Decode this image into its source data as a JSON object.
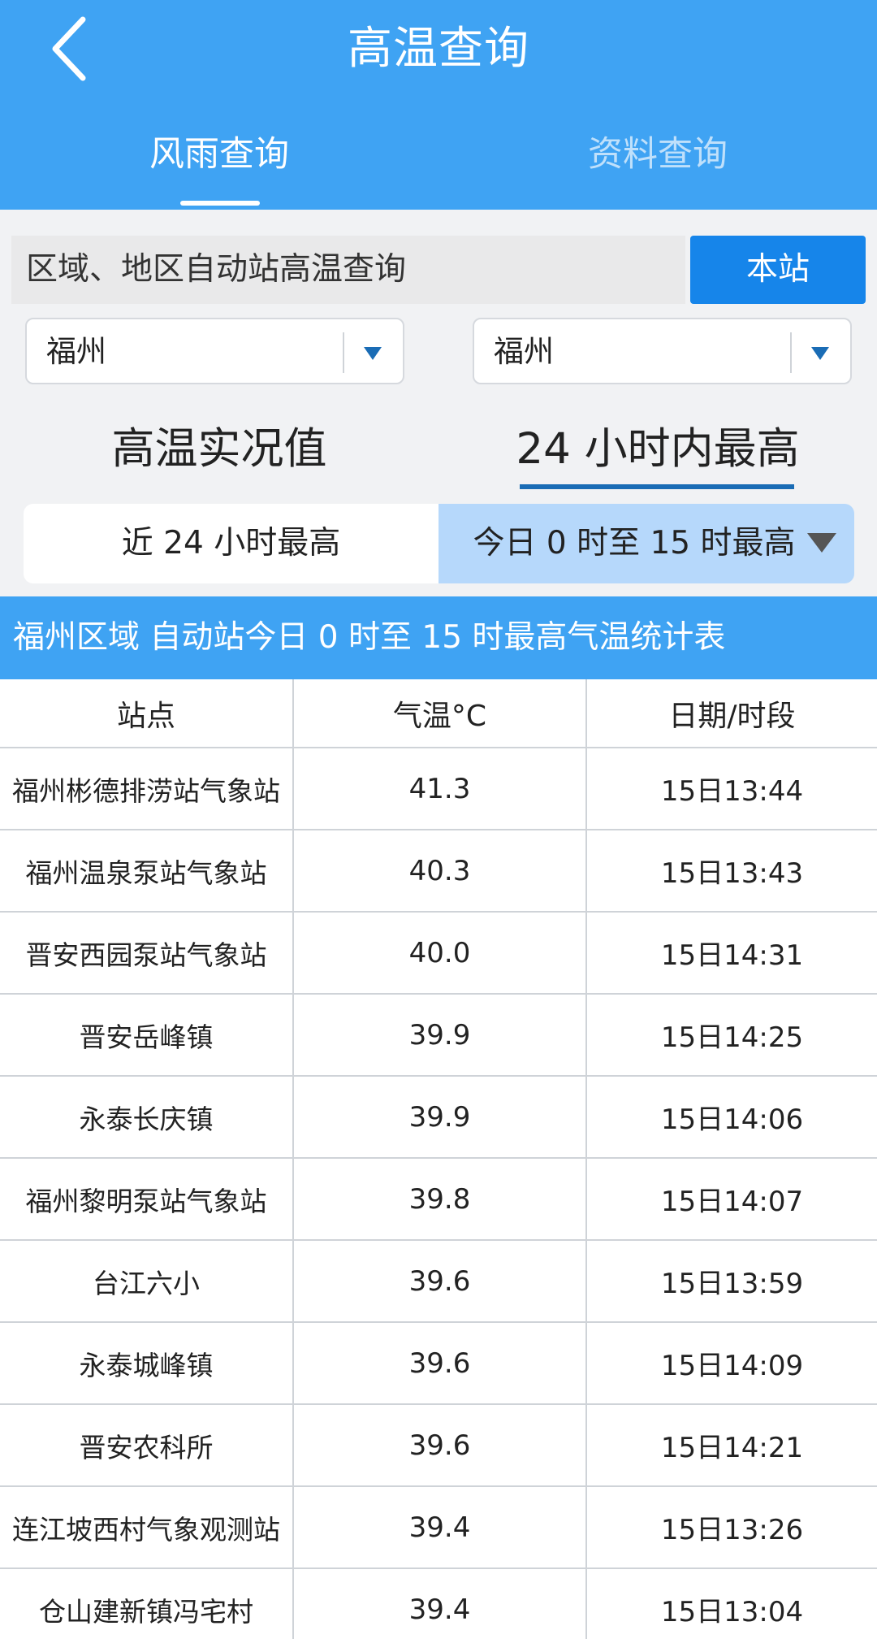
{
  "header": {
    "title": "高温查询",
    "tabs": [
      {
        "label": "风雨查询",
        "active": true
      },
      {
        "label": "资料查询",
        "active": false
      }
    ]
  },
  "query": {
    "label": "区域、地区自动站高温查询",
    "station_button": "本站"
  },
  "selects": {
    "region": "福州",
    "area": "福州"
  },
  "mode_tabs": {
    "realtime": "高温实况值",
    "max24": "24 小时内最高"
  },
  "segments": {
    "last24": "近 24 小时最高",
    "today": "今日 0 时至 15 时最高"
  },
  "banner": "福州区域 自动站今日 0 时至 15 时最高气温统计表",
  "table": {
    "headers": [
      "站点",
      "气温°C",
      "日期/时段"
    ],
    "rows": [
      {
        "name": "福州彬德排涝站气象站",
        "temp": "41.3",
        "time": "15日13:44"
      },
      {
        "name": "福州温泉泵站气象站",
        "temp": "40.3",
        "time": "15日13:43"
      },
      {
        "name": "晋安西园泵站气象站",
        "temp": "40.0",
        "time": "15日14:31"
      },
      {
        "name": "晋安岳峰镇",
        "temp": "39.9",
        "time": "15日14:25"
      },
      {
        "name": "永泰长庆镇",
        "temp": "39.9",
        "time": "15日14:06"
      },
      {
        "name": "福州黎明泵站气象站",
        "temp": "39.8",
        "time": "15日14:07"
      },
      {
        "name": "台江六小",
        "temp": "39.6",
        "time": "15日13:59"
      },
      {
        "name": "永泰城峰镇",
        "temp": "39.6",
        "time": "15日14:09"
      },
      {
        "name": "晋安农科所",
        "temp": "39.6",
        "time": "15日14:21"
      },
      {
        "name": "连江坡西村气象观测站",
        "temp": "39.4",
        "time": "15日13:26"
      },
      {
        "name": "仓山建新镇冯宅村",
        "temp": "39.4",
        "time": "15日13:04"
      }
    ]
  },
  "colors": {
    "header_bg": "#3fa3f3",
    "button_bg": "#1685ea",
    "segment_active_bg": "#b6d8fb",
    "underline": "#1a6cb5"
  },
  "icons": {
    "back": "chevron-left-icon",
    "dropdown": "triangle-down-icon"
  }
}
